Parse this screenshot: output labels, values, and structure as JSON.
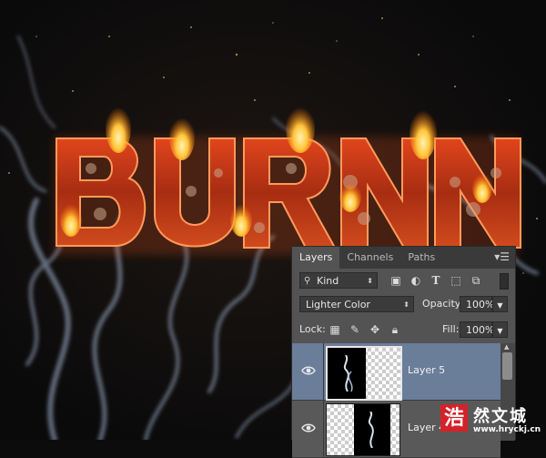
{
  "artwork": {
    "text": "BURN",
    "colors": {
      "fill": "#b8341c",
      "glow": "#ff7a1a",
      "flame": "#ffcf4a",
      "smoke": "#9fb3d4"
    }
  },
  "panel": {
    "tabs": [
      "Layers",
      "Channels",
      "Paths"
    ],
    "active_tab": "Layers",
    "filter": {
      "label": "Kind"
    },
    "blend_mode": "Lighter Color",
    "opacity_label": "Opacity:",
    "opacity_value": "100%",
    "lock_label": "Lock:",
    "fill_label": "Fill:",
    "fill_value": "100%",
    "layers": [
      {
        "name": "Layer 5",
        "selected": true,
        "visible": true
      },
      {
        "name": "Layer 4",
        "selected": false,
        "visible": true
      }
    ],
    "colors": {
      "selected_row": "#6a7e99",
      "panel": "#535353"
    }
  },
  "watermark": {
    "seal": "浩",
    "name": "然文城",
    "url": "www.hryckj.cn"
  }
}
